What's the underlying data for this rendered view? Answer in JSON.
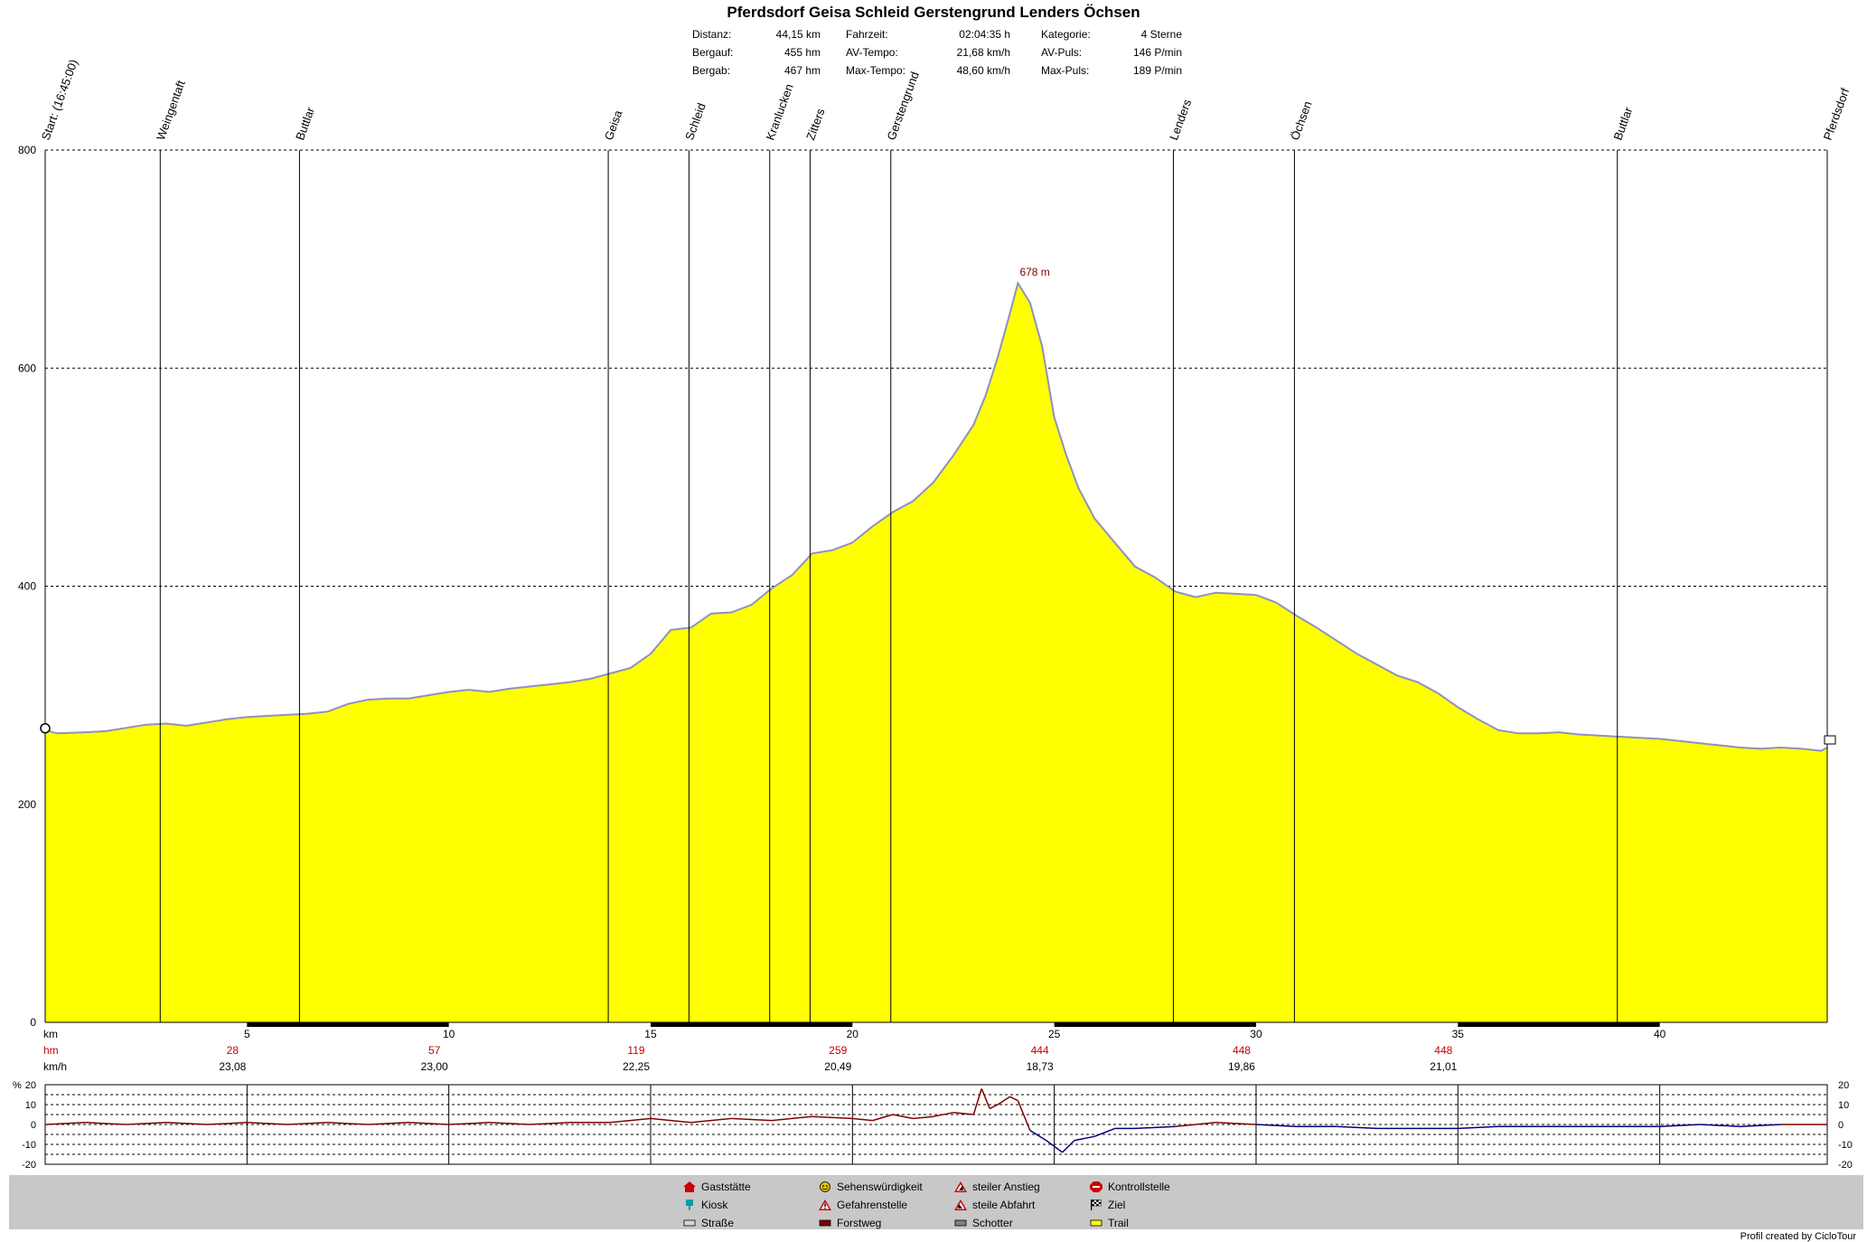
{
  "title": "Pferdsdorf Geisa Schleid Gerstengrund Lenders Öchsen",
  "stats": [
    {
      "label": "Distanz:",
      "value": "44,15 km"
    },
    {
      "label": "Bergauf:",
      "value": "455 hm"
    },
    {
      "label": "Bergab:",
      "value": "467 hm"
    },
    {
      "label": "Fahrzeit:",
      "value": "02:04:35 h"
    },
    {
      "label": "AV-Tempo:",
      "value": "21,68 km/h"
    },
    {
      "label": "Max-Tempo:",
      "value": "48,60 km/h"
    },
    {
      "label": "Kategorie:",
      "value": "4 Sterne"
    },
    {
      "label": "AV-Puls:",
      "value": "146 P/min"
    },
    {
      "label": "Max-Puls:",
      "value": "189 P/min"
    }
  ],
  "chart_data": [
    {
      "type": "area",
      "xlim": [
        0,
        44.15
      ],
      "ylim": [
        0,
        800
      ],
      "yticks": [
        0,
        200,
        400,
        600,
        800
      ],
      "xticks": [
        5,
        10,
        15,
        20,
        25,
        30,
        35,
        40
      ],
      "xlabel": "km",
      "grid": true,
      "fill_color": "#ffff00",
      "line_color": "#9090c0",
      "peak_label": "678 m",
      "peak": {
        "x": 24.1,
        "y": 678
      },
      "x": [
        0,
        0.3,
        1,
        1.5,
        2,
        2.5,
        3,
        3.5,
        4,
        4.5,
        5,
        5.5,
        6,
        6.5,
        7,
        7.5,
        8,
        8.5,
        9,
        9.5,
        10,
        10.5,
        11,
        11.5,
        12,
        12.5,
        13,
        13.5,
        14,
        14.5,
        15,
        15.5,
        16,
        16.5,
        17,
        17.5,
        18,
        18.5,
        19,
        19.5,
        20,
        20.5,
        21,
        21.5,
        22,
        22.5,
        23,
        23.3,
        23.6,
        23.9,
        24.1,
        24.4,
        24.7,
        25,
        25.3,
        25.6,
        26,
        26.5,
        27,
        27.5,
        28,
        28.5,
        29,
        29.5,
        30,
        30.5,
        31,
        31.5,
        32,
        32.5,
        33,
        33.5,
        34,
        34.5,
        35,
        35.5,
        36,
        36.5,
        37,
        37.5,
        38,
        38.5,
        39,
        39.5,
        40,
        40.5,
        41,
        41.5,
        42,
        42.5,
        43,
        43.5,
        44,
        44.15
      ],
      "y": [
        268,
        265,
        266,
        267,
        270,
        273,
        274,
        272,
        275,
        278,
        280,
        281,
        282,
        283,
        285,
        292,
        296,
        297,
        297,
        300,
        303,
        305,
        303,
        306,
        308,
        310,
        312,
        315,
        320,
        325,
        338,
        360,
        362,
        375,
        376,
        383,
        398,
        410,
        430,
        433,
        440,
        455,
        468,
        478,
        495,
        520,
        548,
        575,
        610,
        650,
        678,
        660,
        620,
        555,
        520,
        490,
        462,
        440,
        418,
        408,
        395,
        390,
        394,
        393,
        392,
        385,
        373,
        362,
        350,
        338,
        328,
        318,
        312,
        302,
        289,
        278,
        268,
        265,
        265,
        266,
        264,
        263,
        262,
        261,
        260,
        258,
        256,
        254,
        252,
        251,
        252,
        251,
        249,
        252
      ],
      "markers": [
        {
          "x": 0,
          "label": "Start: (16:45:00)"
        },
        {
          "x": 2.85,
          "label": "Weingentaft"
        },
        {
          "x": 6.3,
          "label": "Buttlar"
        },
        {
          "x": 13.95,
          "label": "Geisa"
        },
        {
          "x": 15.95,
          "label": "Schleid"
        },
        {
          "x": 17.95,
          "label": "Kranlucken"
        },
        {
          "x": 18.95,
          "label": "Zitters"
        },
        {
          "x": 20.95,
          "label": "Gerstengrund"
        },
        {
          "x": 27.95,
          "label": "Lenders"
        },
        {
          "x": 30.95,
          "label": "Öchsen"
        },
        {
          "x": 38.95,
          "label": "Buttlar"
        },
        {
          "x": 44.15,
          "label": "Pferdsdorf"
        }
      ],
      "segments": {
        "rows": [
          {
            "label": "hm",
            "values": [
              "28",
              "57",
              "119",
              "259",
              "444",
              "448",
              "448"
            ]
          },
          {
            "label": "km/h",
            "values": [
              "23,08",
              "23,00",
              "22,25",
              "20,49",
              "18,73",
              "19,86",
              "21,01"
            ]
          }
        ],
        "positions_km": [
          5,
          10,
          15,
          20,
          25,
          30,
          35
        ]
      }
    },
    {
      "type": "line",
      "ylabel": "%",
      "ylim": [
        -20,
        20
      ],
      "yticks": [
        20,
        10,
        0,
        -10,
        -20
      ],
      "x": [
        0,
        1,
        2,
        3,
        4,
        5,
        6,
        7,
        8,
        9,
        10,
        11,
        12,
        13,
        14,
        15,
        16,
        17,
        18,
        19,
        20,
        20.5,
        21,
        21.5,
        22,
        22.5,
        23,
        23.2,
        23.4,
        23.6,
        23.9,
        24.1,
        24.4,
        24.8,
        25.2,
        25.5,
        26,
        26.5,
        27,
        28,
        29,
        30,
        31,
        32,
        33,
        34,
        35,
        36,
        37,
        38,
        39,
        40,
        41,
        42,
        43,
        44,
        44.15
      ],
      "y": [
        0,
        1,
        0,
        1,
        0,
        1,
        0,
        1,
        0,
        1,
        0,
        1,
        0,
        1,
        1,
        3,
        1,
        3,
        2,
        4,
        3,
        2,
        5,
        3,
        4,
        6,
        5,
        18,
        8,
        10,
        14,
        12,
        -3,
        -8,
        -14,
        -8,
        -6,
        -2,
        -2,
        -1,
        1,
        0,
        -1,
        -1,
        -2,
        -2,
        -2,
        -1,
        -1,
        -1,
        -1,
        -1,
        0,
        -1,
        0,
        0,
        0
      ],
      "gradient_colors": {
        "up": "#800000",
        "down": "#000080"
      }
    }
  ],
  "legend": [
    {
      "icon": "house-icon",
      "label": "Gaststätte",
      "color": "#cc0000"
    },
    {
      "icon": "smiley-icon",
      "label": "Sehenswürdigkeit",
      "color": "#e0c000"
    },
    {
      "icon": "warning-triangle-icon",
      "label": "steiler Anstieg",
      "color": "#cc0000"
    },
    {
      "icon": "stop-sign-icon",
      "label": "Kontrollstelle",
      "color": "#cc0000"
    },
    {
      "icon": "kiosk-icon",
      "label": "Kiosk",
      "color": "#00a0a0"
    },
    {
      "icon": "danger-icon",
      "label": "Gefahrenstelle",
      "color": "#cc0000"
    },
    {
      "icon": "warning-triangle-icon",
      "label": "steile Abfahrt",
      "color": "#cc0000"
    },
    {
      "icon": "checkered-flag-icon",
      "label": "Ziel",
      "color": "#000000"
    },
    {
      "icon": "road-swatch",
      "label": "Straße",
      "color": "#d8d8d8"
    },
    {
      "icon": "forest-road-swatch",
      "label": "Forstweg",
      "color": "#800000"
    },
    {
      "icon": "gravel-swatch",
      "label": "Schotter",
      "color": "#808080"
    },
    {
      "icon": "trail-swatch",
      "label": "Trail",
      "color": "#ffff00"
    }
  ],
  "credit": "Profil created by CicloTour"
}
